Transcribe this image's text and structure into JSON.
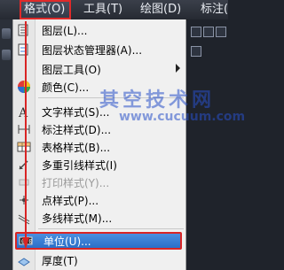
{
  "menubar": {
    "items": [
      {
        "label": "格式(O)",
        "active": true
      },
      {
        "label": "工具(T)"
      },
      {
        "label": "绘图(D)"
      },
      {
        "label": "标注("
      }
    ]
  },
  "watermark": {
    "text": "其空技术网",
    "url": "www.cucuum.com"
  },
  "menu": {
    "items": [
      {
        "label": "图层(L)...",
        "icon": "layer-icon"
      },
      {
        "label": "图层状态管理器(A)...",
        "icon": "layer-state-icon"
      },
      {
        "label": "图层工具(O)",
        "icon": "layer-tools-icon",
        "submenu": true
      },
      {
        "label": "颜色(C)...",
        "icon": "color-wheel-icon"
      },
      {
        "label": "文字样式(S)...",
        "icon": "text-style-icon"
      },
      {
        "label": "标注样式(D)...",
        "icon": "dim-style-icon"
      },
      {
        "label": "表格样式(B)...",
        "icon": "table-style-icon"
      },
      {
        "label": "多重引线样式(I)",
        "icon": "mleader-style-icon"
      },
      {
        "label": "打印样式(Y)...",
        "icon": "plot-style-icon",
        "disabled": true
      },
      {
        "label": "点样式(P)...",
        "icon": "point-style-icon"
      },
      {
        "label": "多线样式(M)...",
        "icon": "mline-style-icon"
      },
      {
        "label": "单位(U)...",
        "icon": "units-icon",
        "highlighted": true
      },
      {
        "label": "厚度(T)",
        "icon": "thickness-icon"
      }
    ]
  },
  "colors": {
    "highlight": "#2b6fc8",
    "callout_red": "#d92525",
    "menubar": "#262a32"
  }
}
